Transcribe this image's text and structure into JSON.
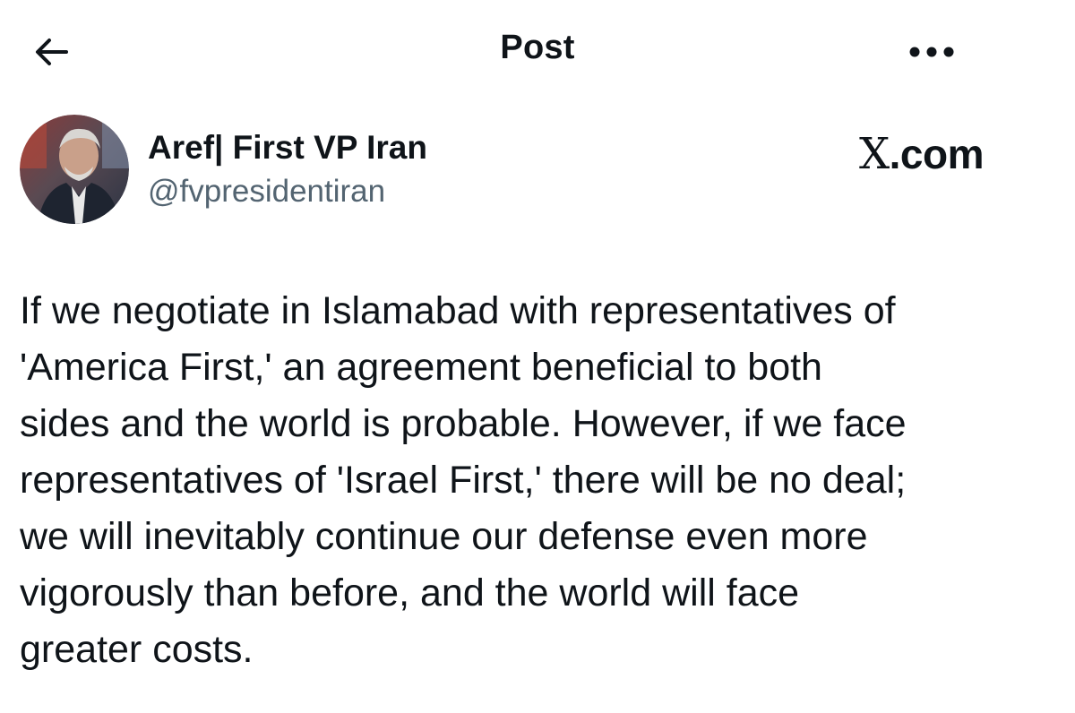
{
  "header": {
    "title": "Post",
    "back_icon": "arrow-left-icon",
    "more_icon": "more-horizontal-icon"
  },
  "author": {
    "display_name": "Aref| First VP Iran",
    "handle": "@fvpresidentiran",
    "avatar": "profile-photo"
  },
  "source": {
    "label": ".com",
    "logo_letter": "X"
  },
  "post": {
    "lines": [
      "If we negotiate in Islamabad with representatives of",
      "'America First,' an agreement beneficial to both",
      "sides and the world is probable. However, if we face",
      "representatives of 'Israel First,' there will be no deal;",
      "we will inevitably continue our defense even more",
      "vigorously than before, and the world will face",
      "greater costs."
    ]
  },
  "colors": {
    "text": "#0f1419",
    "secondary_text": "#536471",
    "background": "#ffffff"
  }
}
